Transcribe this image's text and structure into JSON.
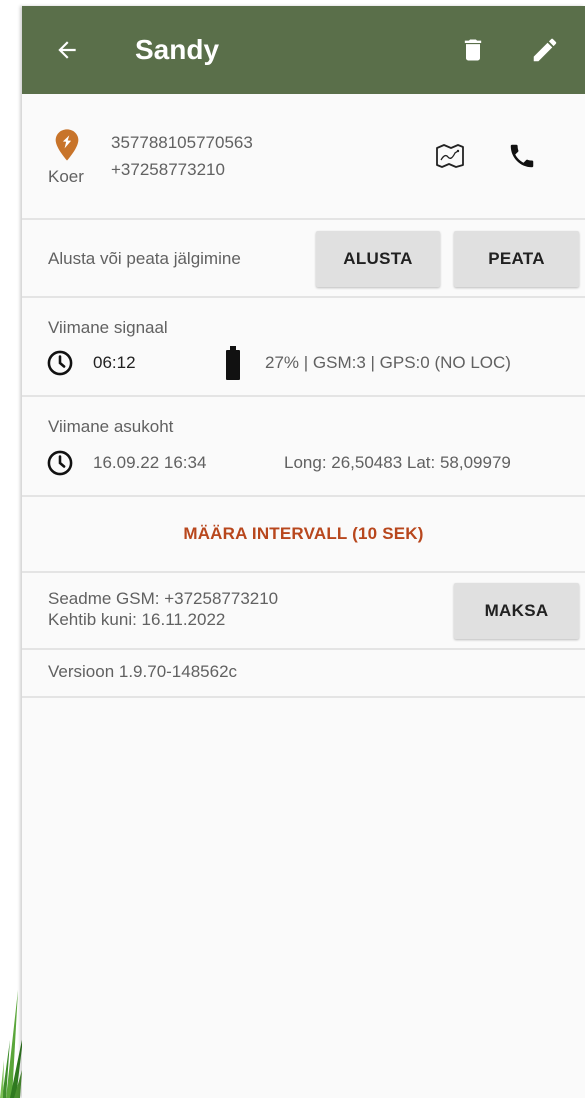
{
  "appbar": {
    "title": "Sandy",
    "back_icon": "arrow-left-icon",
    "delete_icon": "trash-icon",
    "edit_icon": "pencil-icon",
    "background": "#5a6f4a"
  },
  "device": {
    "icon": "map-pin-icon",
    "icon_color": "#c8742a",
    "type_label": "Koer",
    "imei": "357788105770563",
    "phone": "+37258773210",
    "map_icon": "map-icon",
    "call_icon": "phone-icon"
  },
  "tracking": {
    "label": "Alusta või peata jälgimine",
    "start_label": "ALUSTA",
    "stop_label": "PEATA"
  },
  "last_signal": {
    "heading": "Viimane signaal",
    "time": "06:12",
    "status": "27% | GSM:3 | GPS:0 (NO LOC)",
    "battery_percent": 27
  },
  "last_location": {
    "heading": "Viimane asukoht",
    "datetime": "16.09.22 16:34",
    "coords": "Long: 26,50483 Lat: 58,09979"
  },
  "interval": {
    "label": "MÄÄRA INTERVALL (10 SEK)",
    "color": "#b8471d"
  },
  "subscription": {
    "gsm": "Seadme GSM: +37258773210",
    "valid_until": "Kehtib kuni: 16.11.2022",
    "pay_label": "MAKSA"
  },
  "version": "Versioon 1.9.70-148562c"
}
